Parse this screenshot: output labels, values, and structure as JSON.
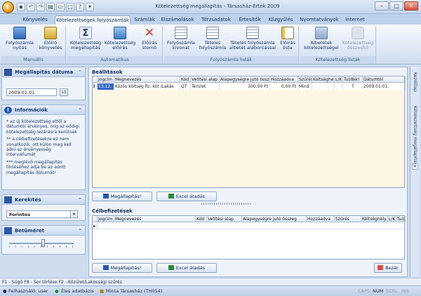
{
  "window": {
    "title": "Kötelezettség megállapítás - Társasház-Érték 2009",
    "app_orb_letter": "T",
    "quick_access": [
      "save-icon",
      "undo-icon",
      "redo-icon",
      "print-icon",
      "folder-icon",
      "window-icon",
      "help-icon",
      "dropdown-icon"
    ]
  },
  "tabs": [
    {
      "label": "Könyvelés"
    },
    {
      "label": "Kötelezettségek,folyószámlák",
      "active": true
    },
    {
      "label": "Számlák"
    },
    {
      "label": "Elszámolások"
    },
    {
      "label": "Törzsadatok"
    },
    {
      "label": "Értesítők"
    },
    {
      "label": "Közgyűlés"
    },
    {
      "label": "Nyomtatványok"
    },
    {
      "label": "Internet"
    }
  ],
  "ribbon": {
    "groups": [
      {
        "label": "Manuális",
        "buttons": [
          {
            "line1": "Folyószámla",
            "line2": "nyitás",
            "icon": "book-person-icon"
          },
          {
            "line1": "Előíró",
            "line2": "könyvelés",
            "icon": "pencil-book-icon"
          }
        ]
      },
      {
        "label": "Automatikus",
        "buttons": [
          {
            "line1": "Kötelezettség",
            "line2": "megállapítás",
            "icon": "sigma-icon"
          },
          {
            "line1": "Kötelezettség",
            "line2": "előírás",
            "icon": "person-doc-icon"
          },
          {
            "line1": "Előírás",
            "line2": "stornó",
            "icon": "red-x-icon"
          }
        ]
      },
      {
        "label": "Folyószámla listák",
        "buttons": [
          {
            "line1": "Folyószámla",
            "line2": "kivonat",
            "icon": "document-list-icon"
          },
          {
            "line1": "Tételes",
            "line2": "folyószámla",
            "icon": "document-list-icon"
          },
          {
            "line1": "Tételes folyószámla",
            "line2": "albetét alábontással",
            "icon": "document-list-icon"
          },
          {
            "line1": "Előírás",
            "line2": "lista",
            "icon": "list-icon"
          }
        ]
      },
      {
        "label": "Kötelezettség listák",
        "buttons": [
          {
            "line1": "Albetétek",
            "line2": "kötelezettségei",
            "icon": "person-list-icon"
          },
          {
            "line1": "Kötelezettség",
            "line2": "összesítő",
            "icon": "lock-icon",
            "disabled": true
          }
        ]
      }
    ]
  },
  "left_panel": {
    "date_section": {
      "title": "Megállapítás dátuma",
      "value": "2009.01.01",
      "calendar_button": "15"
    },
    "info_section": {
      "title": "Információk",
      "lines": [
        "* az új kötelezettség ettől a dátumtól érvényes, míg az eddigi kötelezettség lezárásra kerülnek",
        "** a célbefizetésekre ez nem vonatkozik, ott külön meg kell adni az érvényesség intervallumát",
        "*** meglévő megállapítás törléséhez adja be az adott megállapítás dátumát!"
      ]
    },
    "rounding_section": {
      "title": "Kerekítés",
      "value": "Forintos"
    },
    "font_size_section": {
      "title": "Betűméret"
    }
  },
  "main": {
    "settings": {
      "title": "Beállítások",
      "columns": [
        "Jogcím",
        "Megnevezés",
        "Kód",
        "Vetítési alap",
        "Alapegységre jutó összeg",
        "Hozzáadva",
        "Szűrés",
        "Költséghely",
        "L/K",
        "Tul/Bérl",
        "Dátumtól"
      ],
      "rows": [
        {
          "marker": "I",
          "jogcim": "13.12.",
          "megnevezes": "Közös költség fiz. köt /Lakás",
          "kod": "QT",
          "vetitesi_alap": "Terület",
          "alapegyseg": "300,00 Ft",
          "hozzaadva": "0,00 Ft",
          "szures": "Mind",
          "koltseghely": "",
          "lk": "",
          "tulberl": "T",
          "datumtol": "2009.01.01."
        }
      ],
      "buttons": {
        "save": "Megállapítás!",
        "excel": "Excel átadás"
      }
    },
    "target_payments": {
      "title": "Célbefizetések",
      "columns": [
        "Jogcím",
        "Megnevezés",
        "Kód",
        "Vetítési alap",
        "Alapegységre jutó összeg",
        "Hozzáadva",
        "Szűrés",
        "Költséghely",
        "L/K",
        "Tul/"
      ],
      "buttons": {
        "save": "Megállapítás!",
        "excel": "Excel átadás",
        "close": "Bezár"
      }
    }
  },
  "side_tabs": [
    "Kezdőlap",
    "Kötelezettség megállapítás"
  ],
  "hint_bar": "F1 - Súgó   F8 - Sor törlése   F2 - Közület/Lakossági szűrés",
  "status_bar": {
    "user": "Felhasználó: user",
    "database": "Éles adatbázis",
    "company": "Minta Társasház (TH054)",
    "caps": "CAPS",
    "num": "NUM",
    "scrl": "SCRL",
    "ins": "INS"
  },
  "colors": {
    "accent_blue": "#2b57a8",
    "ribbon_bg": "#dce7f5",
    "grid_bg": "#fbf7e2",
    "close_red": "#d2503a"
  }
}
